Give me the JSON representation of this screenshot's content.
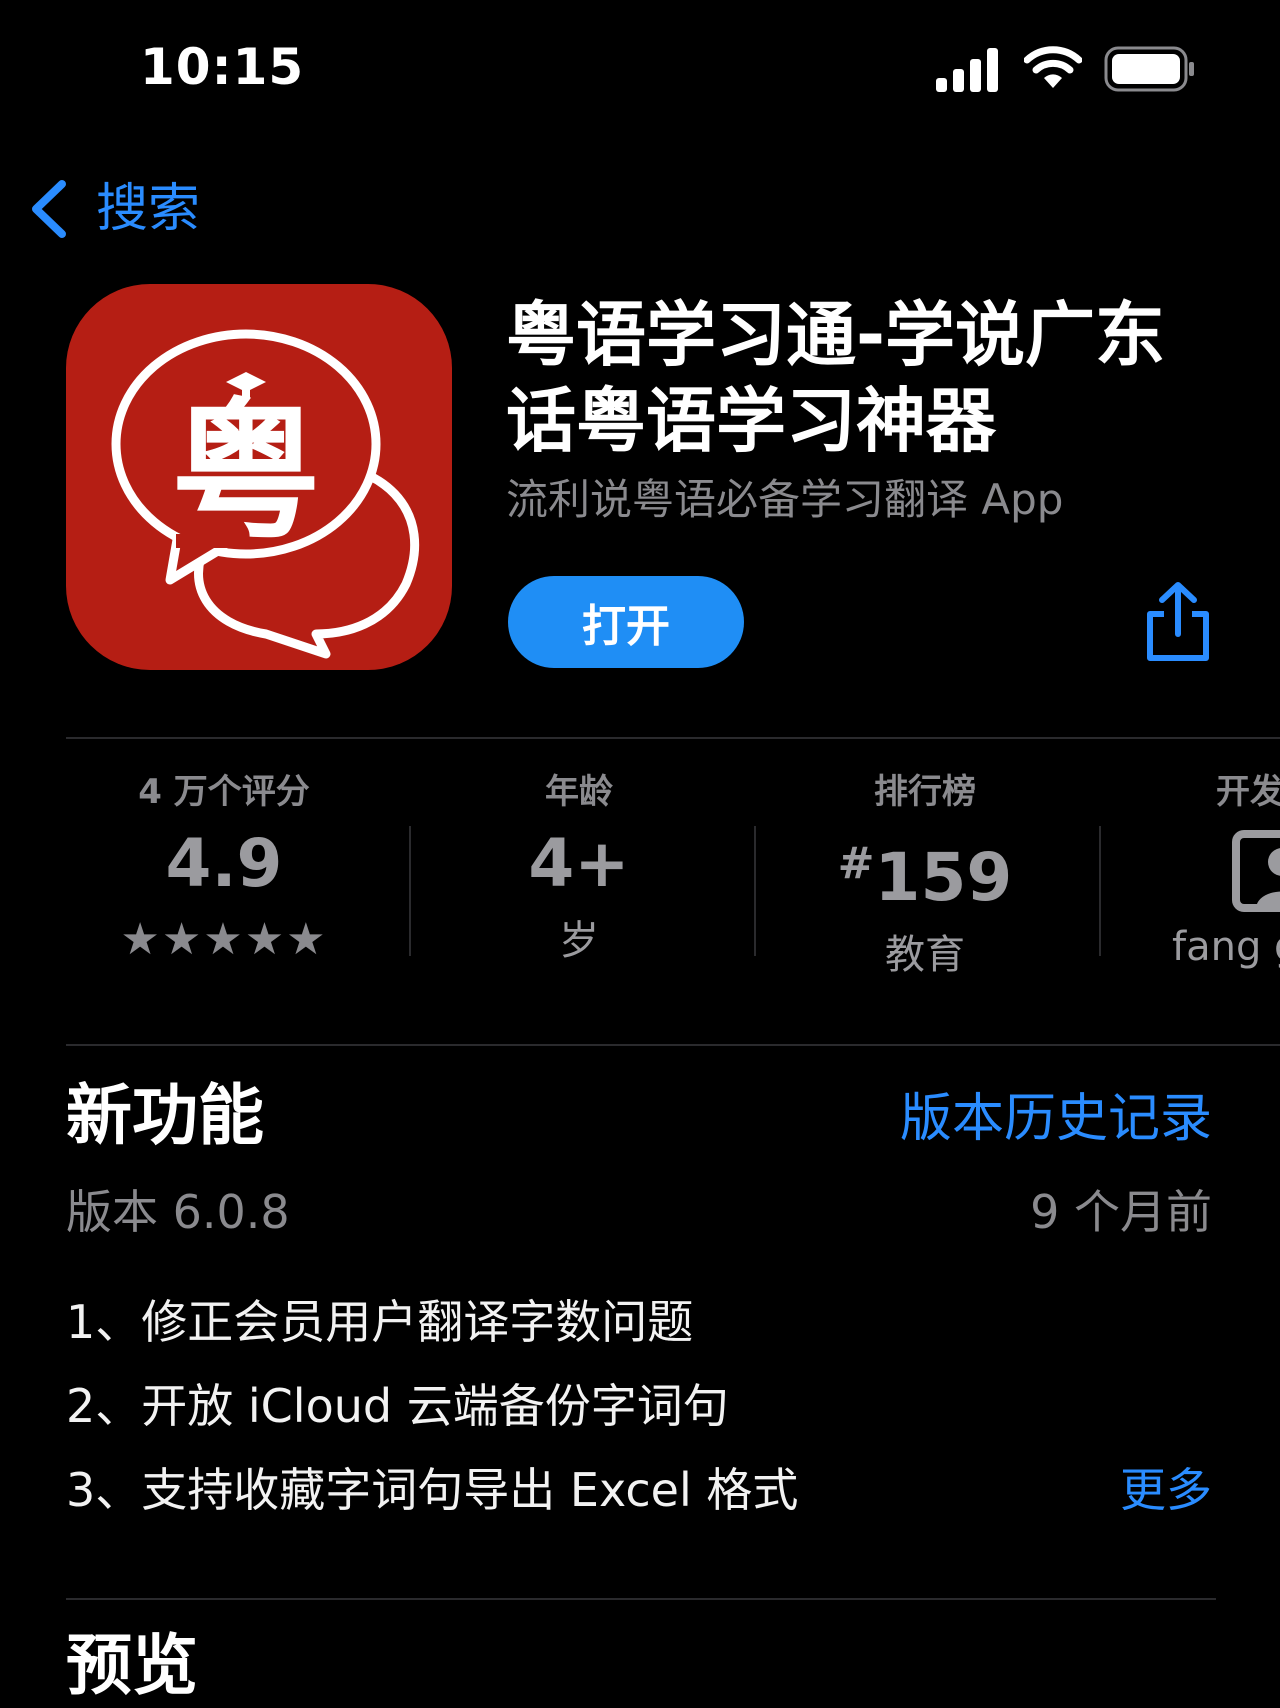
{
  "status_bar": {
    "time": "10:15",
    "signal_icon": "cellular-signal-icon",
    "wifi_icon": "wifi-icon",
    "battery_icon": "battery-icon"
  },
  "nav": {
    "back_label": "搜索",
    "back_icon": "chevron-left-icon"
  },
  "app": {
    "icon_glyph": "粤",
    "icon_color": "#b51e14",
    "title": "粤语学习通-学说广东话粤语学习神器",
    "subtitle": "流利说粤语必备学习翻译 App",
    "open_label": "打开",
    "share_icon": "share-icon",
    "accent_color": "#1f8ef5"
  },
  "info": {
    "ratings": {
      "label": "4 万个评分",
      "value": "4.9",
      "stars": "★★★★★"
    },
    "age": {
      "label": "年龄",
      "value": "4+",
      "sub": "岁"
    },
    "chart": {
      "label": "排行榜",
      "value_prefix": "#",
      "value": "159",
      "sub": "教育"
    },
    "developer": {
      "label": "开发",
      "sub": "fang g",
      "icon": "person-icon"
    }
  },
  "whats_new": {
    "title": "新功能",
    "history_link": "版本历史记录",
    "version": "版本 6.0.8",
    "time_ago": "9 个月前",
    "notes": [
      "1、修正会员用户翻译字数问题",
      "2、开放 iCloud 云端备份字词句",
      "3、支持收藏字词句导出 Excel 格式"
    ],
    "more_label": "更多"
  },
  "preview": {
    "title": "预览"
  }
}
